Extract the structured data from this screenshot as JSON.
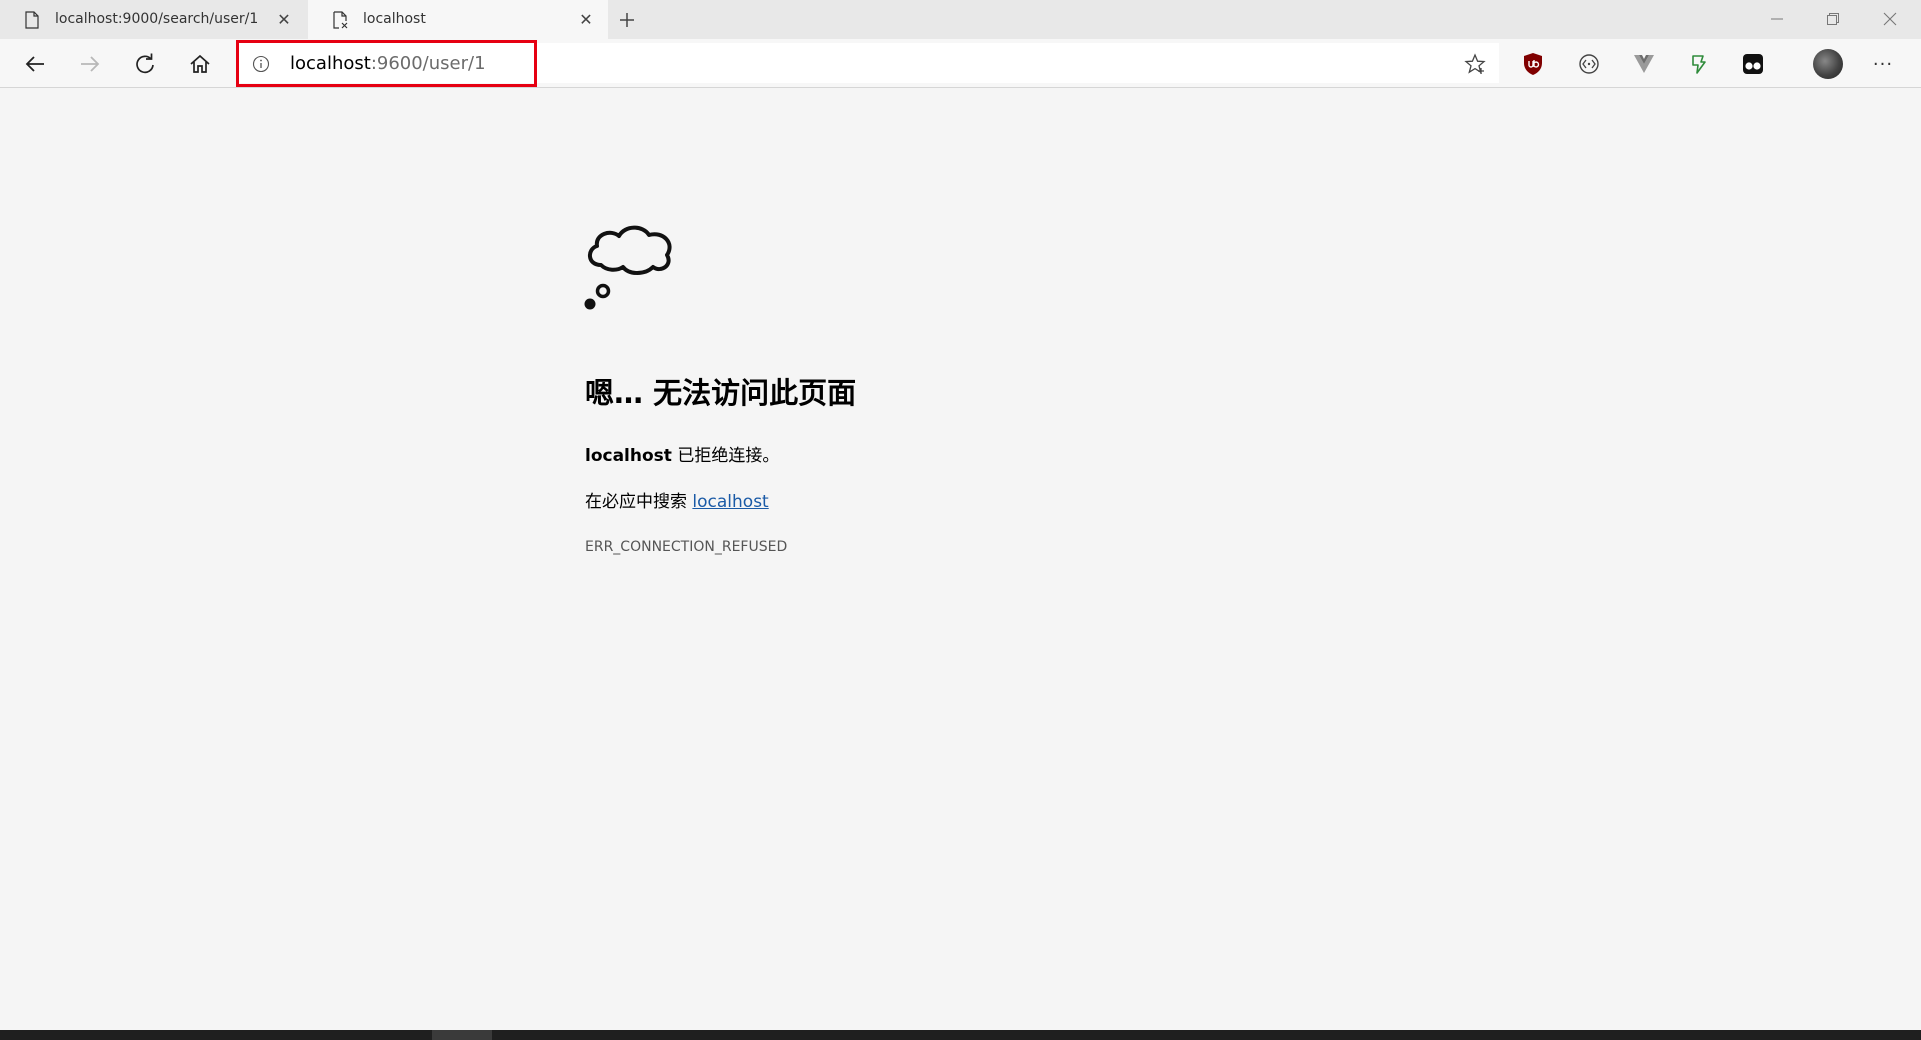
{
  "tabs": [
    {
      "title": "localhost:9000/search/user/1",
      "active": false
    },
    {
      "title": "localhost",
      "active": true
    }
  ],
  "new_tab_label": "+",
  "toolbar": {
    "url_host": "localhost",
    "url_path": ":9600/user/1",
    "icons": [
      "back-icon",
      "forward-icon",
      "refresh-icon",
      "home-icon",
      "info-icon",
      "star-icon"
    ]
  },
  "extensions": [
    "ublock-origin-icon",
    "devtools-icon",
    "vue-devtools-icon",
    "green-extension-icon",
    "tampermonkey-icon"
  ],
  "more_label": "···",
  "error_page": {
    "title": "嗯… 无法访问此页面",
    "host": "localhost",
    "desc_suffix": " 已拒绝连接。",
    "search_prefix": "在必应中搜索 ",
    "search_link": "localhost",
    "error_code": "ERR_CONNECTION_REFUSED"
  },
  "colors": {
    "highlight_border": "#e60012",
    "link": "#1a5aa6",
    "page_bg": "#f5f5f5"
  }
}
